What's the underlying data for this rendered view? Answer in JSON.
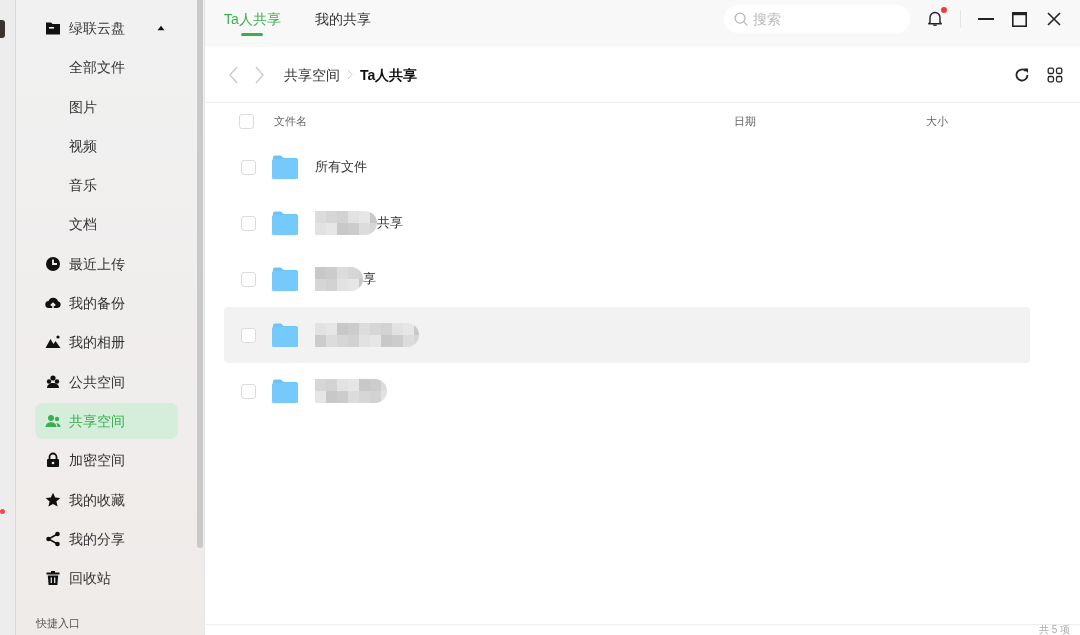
{
  "sidebar": {
    "items": [
      {
        "label": "绿联云盘",
        "expanded": true,
        "selected": false,
        "children": [
          {
            "label": "全部文件",
            "selected": false
          },
          {
            "label": "图片",
            "selected": false
          },
          {
            "label": "视频",
            "selected": false
          },
          {
            "label": "音乐",
            "selected": false
          },
          {
            "label": "文档",
            "selected": false
          }
        ]
      },
      {
        "label": "最近上传",
        "selected": false
      },
      {
        "label": "我的备份",
        "selected": false
      },
      {
        "label": "我的相册",
        "selected": false
      },
      {
        "label": "公共空间",
        "selected": false
      },
      {
        "label": "共享空间",
        "selected": true
      },
      {
        "label": "加密空间",
        "selected": false
      },
      {
        "label": "我的收藏",
        "selected": false
      },
      {
        "label": "我的分享",
        "selected": false
      },
      {
        "label": "回收站",
        "selected": false
      }
    ],
    "section_label": "快捷入口"
  },
  "tabs": [
    {
      "label": "Ta人共享",
      "selected": true
    },
    {
      "label": "我的共享",
      "selected": false
    }
  ],
  "search": {
    "placeholder": "搜索"
  },
  "notifications": {
    "unread": true
  },
  "navigation": {
    "back_disabled": true,
    "forward_disabled": true
  },
  "breadcrumb": [
    {
      "label": "共享空间",
      "current": false
    },
    {
      "label": "Ta人共享",
      "current": true
    }
  ],
  "table": {
    "all_checked": false,
    "columns": [
      "文件名",
      "日期",
      "大小"
    ],
    "rows": [
      {
        "name": "所有文件",
        "checked": false,
        "selected": false,
        "redacted": false
      },
      {
        "name": "共享",
        "checked": false,
        "selected": false,
        "redacted": true
      },
      {
        "name": "享",
        "checked": false,
        "selected": false,
        "redacted": true
      },
      {
        "checked": false,
        "selected": true,
        "redacted": true
      },
      {
        "checked": false,
        "selected": false,
        "redacted": true
      }
    ]
  },
  "status_bar": {
    "count": "共 5 项"
  }
}
